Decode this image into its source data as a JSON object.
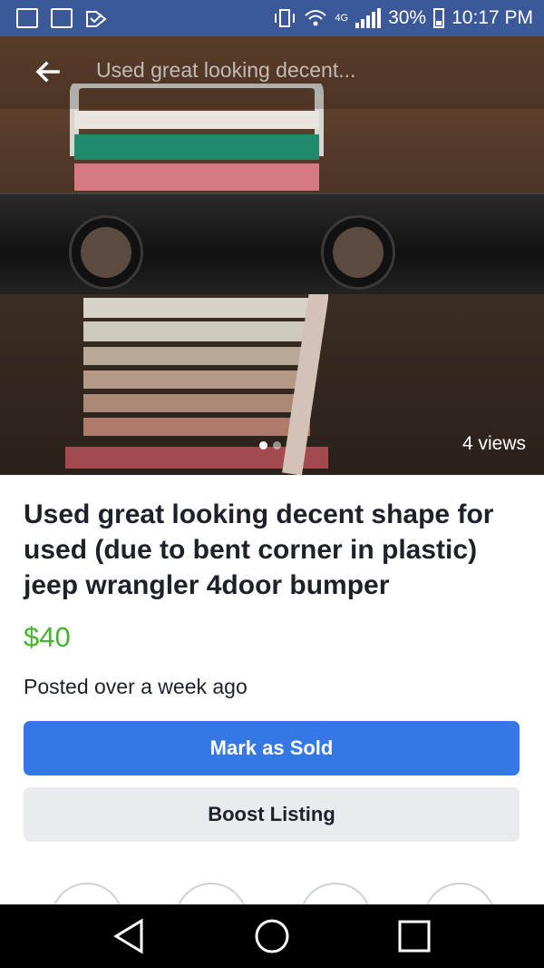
{
  "status_bar": {
    "network": "4G",
    "battery": "30%",
    "time": "10:17 PM"
  },
  "header": {
    "title": "Used great looking decent..."
  },
  "hero": {
    "views": "4 views",
    "page_count": 2,
    "current_page": 1
  },
  "listing": {
    "title": "Used great looking decent shape for used (due to bent corner in plastic) jeep wrangler 4door bumper",
    "price": "$40",
    "posted": "Posted over a week ago"
  },
  "actions": {
    "mark_sold": "Mark as Sold",
    "boost": "Boost Listing"
  },
  "colors": {
    "brand": "#3b5998",
    "primary_button": "#3578e5",
    "price": "#42b72a"
  },
  "icons": {
    "back": "back-arrow-icon",
    "nav_back": "triangle-back-icon",
    "nav_home": "circle-home-icon",
    "nav_recents": "square-recents-icon"
  }
}
